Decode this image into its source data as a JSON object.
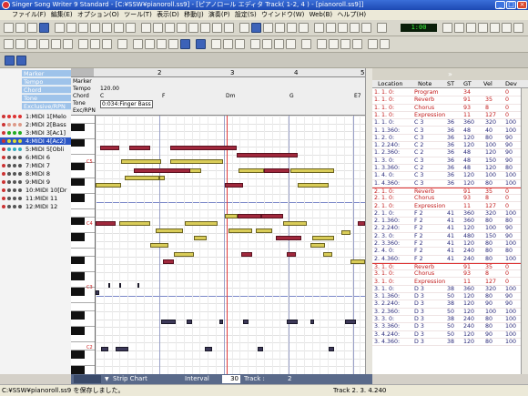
{
  "window": {
    "title": "Singer Song Writer 9 Standard - [C:¥SSW¥pianoroll.ss9] - [ピアノロール エディタ Track( 1-2, 4 ) - [pianoroll.ss9]]"
  },
  "menu": [
    "ファイル(F)",
    "編集(E)",
    "オプション(O)",
    "ツール(T)",
    "表示(D)",
    "移動(J)",
    "演奏(P)",
    "設定(S)",
    "ウインドウ(W)",
    "Web(B)",
    "ヘルプ(H)"
  ],
  "transport": {
    "counter": "1:00"
  },
  "tracks": {
    "labels": [
      "Marker",
      "Tempo",
      "Chord",
      "Tone",
      "Exclusive/RPN"
    ],
    "items": [
      "1:MIDI 1[Melo",
      "2:MIDI 2[Bass",
      "3:MIDI 3[Ac1]",
      "4:MIDI 4[Ac2]",
      "5:MIDI 5[Obli",
      "6:MIDI 6",
      "7:MIDI 7",
      "8:MIDI 8",
      "9:MIDI 9",
      "10:MIDI 10[Dr",
      "11:MIDI 11",
      "12:MIDI 12"
    ]
  },
  "editor": {
    "ruler": [
      "2",
      "3",
      "4",
      "5"
    ],
    "control_labels": [
      "Marker",
      "Tempo",
      "Chord",
      "Tone",
      "Exc/RPN"
    ],
    "tempo_value": "120.00",
    "chord_value": "C",
    "tone_value": "0:034:Finger Bass",
    "chords": [
      "F",
      "Dm",
      "G",
      "E7"
    ],
    "octave_labels": [
      "C5",
      "C4",
      "C3",
      "C2"
    ]
  },
  "bottom": {
    "view": "Strip Chart",
    "interval_label": "Interval",
    "interval_value": "30",
    "track_label": "Track :",
    "track_value": "2"
  },
  "list": {
    "columns": [
      "Location",
      "Note",
      "ST",
      "GT",
      "Vel",
      "Dev"
    ],
    "rows": [
      {
        "loc": "1. 1. 0:",
        "note": "Program",
        "st": "",
        "gt": "34",
        "vel": "",
        "dev": "0",
        "ev": true
      },
      {
        "loc": "1. 1. 0:",
        "note": "Reverb",
        "st": "",
        "gt": "91",
        "vel": "35",
        "dev": "0",
        "ev": true
      },
      {
        "loc": "1. 1. 0:",
        "note": "Chorus",
        "st": "",
        "gt": "93",
        "vel": "8",
        "dev": "0",
        "ev": true
      },
      {
        "loc": "1. 1. 0:",
        "note": "Expression",
        "st": "",
        "gt": "11",
        "vel": "127",
        "dev": "0",
        "ev": true
      },
      {
        "loc": "1. 1. 0:",
        "note": "C 3",
        "st": "36",
        "gt": "360",
        "vel": "320",
        "dev": "100",
        "ev": false
      },
      {
        "loc": "1. 1.360:",
        "note": "C 3",
        "st": "36",
        "gt": "48",
        "vel": "40",
        "dev": "100",
        "ev": false
      },
      {
        "loc": "1. 2. 0:",
        "note": "C 3",
        "st": "36",
        "gt": "120",
        "vel": "80",
        "dev": "90",
        "ev": false
      },
      {
        "loc": "1. 2.240:",
        "note": "C 2",
        "st": "36",
        "gt": "120",
        "vel": "100",
        "dev": "90",
        "ev": false
      },
      {
        "loc": "1. 2.360:",
        "note": "C 2",
        "st": "36",
        "gt": "48",
        "vel": "120",
        "dev": "90",
        "ev": false
      },
      {
        "loc": "1. 3. 0:",
        "note": "C 3",
        "st": "36",
        "gt": "48",
        "vel": "150",
        "dev": "90",
        "ev": false
      },
      {
        "loc": "1. 3.360:",
        "note": "C 2",
        "st": "36",
        "gt": "48",
        "vel": "120",
        "dev": "80",
        "ev": false
      },
      {
        "loc": "1. 4. 0:",
        "note": "C 3",
        "st": "36",
        "gt": "120",
        "vel": "100",
        "dev": "100",
        "ev": false
      },
      {
        "loc": "1. 4.360:",
        "note": "C 3",
        "st": "36",
        "gt": "120",
        "vel": "80",
        "dev": "100",
        "ev": false
      },
      {
        "loc": "2. 1. 0:",
        "note": "Reverb",
        "st": "",
        "gt": "91",
        "vel": "35",
        "dev": "0",
        "ev": true
      },
      {
        "loc": "2. 1. 0:",
        "note": "Chorus",
        "st": "",
        "gt": "93",
        "vel": "8",
        "dev": "0",
        "ev": true
      },
      {
        "loc": "2. 1. 0:",
        "note": "Expression",
        "st": "",
        "gt": "11",
        "vel": "127",
        "dev": "0",
        "ev": true
      },
      {
        "loc": "2. 1. 0:",
        "note": "F 2",
        "st": "41",
        "gt": "360",
        "vel": "320",
        "dev": "100",
        "ev": false
      },
      {
        "loc": "2. 1.360:",
        "note": "F 2",
        "st": "41",
        "gt": "360",
        "vel": "80",
        "dev": "80",
        "ev": false
      },
      {
        "loc": "2. 2.240:",
        "note": "F 2",
        "st": "41",
        "gt": "120",
        "vel": "100",
        "dev": "90",
        "ev": false
      },
      {
        "loc": "2. 3. 0:",
        "note": "F 2",
        "st": "41",
        "gt": "480",
        "vel": "150",
        "dev": "90",
        "ev": false
      },
      {
        "loc": "2. 3.360:",
        "note": "F 2",
        "st": "41",
        "gt": "120",
        "vel": "80",
        "dev": "100",
        "ev": false
      },
      {
        "loc": "2. 4. 0:",
        "note": "F 2",
        "st": "41",
        "gt": "240",
        "vel": "80",
        "dev": "80",
        "ev": false
      },
      {
        "loc": "2. 4.360:",
        "note": "F 2",
        "st": "41",
        "gt": "240",
        "vel": "80",
        "dev": "100",
        "ev": false
      },
      {
        "loc": "3. 1. 0:",
        "note": "Reverb",
        "st": "",
        "gt": "91",
        "vel": "35",
        "dev": "0",
        "ev": true
      },
      {
        "loc": "3. 1. 0:",
        "note": "Chorus",
        "st": "",
        "gt": "93",
        "vel": "8",
        "dev": "0",
        "ev": true
      },
      {
        "loc": "3. 1. 0:",
        "note": "Expression",
        "st": "",
        "gt": "11",
        "vel": "127",
        "dev": "0",
        "ev": true
      },
      {
        "loc": "3. 1. 0:",
        "note": "D 3",
        "st": "38",
        "gt": "360",
        "vel": "320",
        "dev": "100",
        "ev": false
      },
      {
        "loc": "3. 1.360:",
        "note": "D 3",
        "st": "50",
        "gt": "120",
        "vel": "80",
        "dev": "90",
        "ev": false
      },
      {
        "loc": "3. 2.240:",
        "note": "D 3",
        "st": "38",
        "gt": "120",
        "vel": "90",
        "dev": "90",
        "ev": false
      },
      {
        "loc": "3. 2.360:",
        "note": "D 3",
        "st": "50",
        "gt": "120",
        "vel": "100",
        "dev": "100",
        "ev": false
      },
      {
        "loc": "3. 3. 0:",
        "note": "D 3",
        "st": "38",
        "gt": "240",
        "vel": "80",
        "dev": "100",
        "ev": false
      },
      {
        "loc": "3. 3.360:",
        "note": "D 3",
        "st": "50",
        "gt": "240",
        "vel": "80",
        "dev": "100",
        "ev": false
      },
      {
        "loc": "3. 4.240:",
        "note": "D 3",
        "st": "50",
        "gt": "120",
        "vel": "90",
        "dev": "100",
        "ev": false
      },
      {
        "loc": "3. 4.360:",
        "note": "D 3",
        "st": "38",
        "gt": "120",
        "vel": "80",
        "dev": "100",
        "ev": false
      }
    ]
  },
  "status": {
    "message": "C:¥SSW¥pianoroll.ss9 を保存しました。",
    "position": "Track  2.  3. 4.240"
  }
}
